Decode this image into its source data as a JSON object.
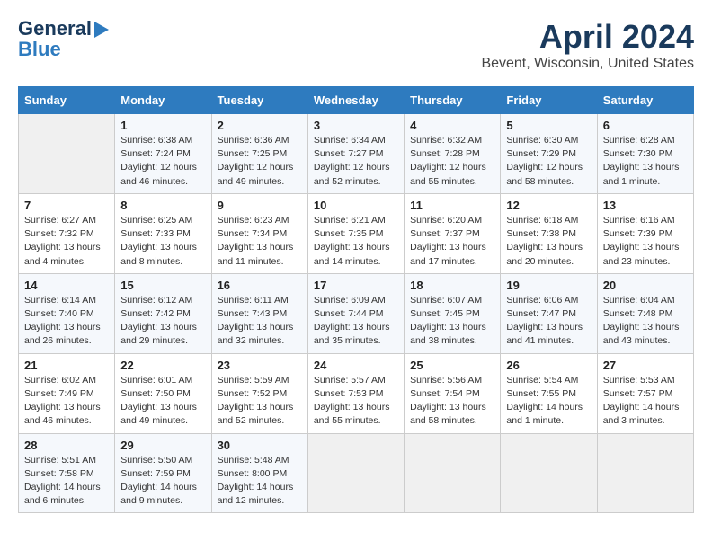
{
  "header": {
    "logo_line1": "General",
    "logo_line2": "Blue",
    "title": "April 2024",
    "subtitle": "Bevent, Wisconsin, United States"
  },
  "days_of_week": [
    "Sunday",
    "Monday",
    "Tuesday",
    "Wednesday",
    "Thursday",
    "Friday",
    "Saturday"
  ],
  "weeks": [
    [
      {
        "day": "",
        "info": ""
      },
      {
        "day": "1",
        "info": "Sunrise: 6:38 AM\nSunset: 7:24 PM\nDaylight: 12 hours\nand 46 minutes."
      },
      {
        "day": "2",
        "info": "Sunrise: 6:36 AM\nSunset: 7:25 PM\nDaylight: 12 hours\nand 49 minutes."
      },
      {
        "day": "3",
        "info": "Sunrise: 6:34 AM\nSunset: 7:27 PM\nDaylight: 12 hours\nand 52 minutes."
      },
      {
        "day": "4",
        "info": "Sunrise: 6:32 AM\nSunset: 7:28 PM\nDaylight: 12 hours\nand 55 minutes."
      },
      {
        "day": "5",
        "info": "Sunrise: 6:30 AM\nSunset: 7:29 PM\nDaylight: 12 hours\nand 58 minutes."
      },
      {
        "day": "6",
        "info": "Sunrise: 6:28 AM\nSunset: 7:30 PM\nDaylight: 13 hours\nand 1 minute."
      }
    ],
    [
      {
        "day": "7",
        "info": "Sunrise: 6:27 AM\nSunset: 7:32 PM\nDaylight: 13 hours\nand 4 minutes."
      },
      {
        "day": "8",
        "info": "Sunrise: 6:25 AM\nSunset: 7:33 PM\nDaylight: 13 hours\nand 8 minutes."
      },
      {
        "day": "9",
        "info": "Sunrise: 6:23 AM\nSunset: 7:34 PM\nDaylight: 13 hours\nand 11 minutes."
      },
      {
        "day": "10",
        "info": "Sunrise: 6:21 AM\nSunset: 7:35 PM\nDaylight: 13 hours\nand 14 minutes."
      },
      {
        "day": "11",
        "info": "Sunrise: 6:20 AM\nSunset: 7:37 PM\nDaylight: 13 hours\nand 17 minutes."
      },
      {
        "day": "12",
        "info": "Sunrise: 6:18 AM\nSunset: 7:38 PM\nDaylight: 13 hours\nand 20 minutes."
      },
      {
        "day": "13",
        "info": "Sunrise: 6:16 AM\nSunset: 7:39 PM\nDaylight: 13 hours\nand 23 minutes."
      }
    ],
    [
      {
        "day": "14",
        "info": "Sunrise: 6:14 AM\nSunset: 7:40 PM\nDaylight: 13 hours\nand 26 minutes."
      },
      {
        "day": "15",
        "info": "Sunrise: 6:12 AM\nSunset: 7:42 PM\nDaylight: 13 hours\nand 29 minutes."
      },
      {
        "day": "16",
        "info": "Sunrise: 6:11 AM\nSunset: 7:43 PM\nDaylight: 13 hours\nand 32 minutes."
      },
      {
        "day": "17",
        "info": "Sunrise: 6:09 AM\nSunset: 7:44 PM\nDaylight: 13 hours\nand 35 minutes."
      },
      {
        "day": "18",
        "info": "Sunrise: 6:07 AM\nSunset: 7:45 PM\nDaylight: 13 hours\nand 38 minutes."
      },
      {
        "day": "19",
        "info": "Sunrise: 6:06 AM\nSunset: 7:47 PM\nDaylight: 13 hours\nand 41 minutes."
      },
      {
        "day": "20",
        "info": "Sunrise: 6:04 AM\nSunset: 7:48 PM\nDaylight: 13 hours\nand 43 minutes."
      }
    ],
    [
      {
        "day": "21",
        "info": "Sunrise: 6:02 AM\nSunset: 7:49 PM\nDaylight: 13 hours\nand 46 minutes."
      },
      {
        "day": "22",
        "info": "Sunrise: 6:01 AM\nSunset: 7:50 PM\nDaylight: 13 hours\nand 49 minutes."
      },
      {
        "day": "23",
        "info": "Sunrise: 5:59 AM\nSunset: 7:52 PM\nDaylight: 13 hours\nand 52 minutes."
      },
      {
        "day": "24",
        "info": "Sunrise: 5:57 AM\nSunset: 7:53 PM\nDaylight: 13 hours\nand 55 minutes."
      },
      {
        "day": "25",
        "info": "Sunrise: 5:56 AM\nSunset: 7:54 PM\nDaylight: 13 hours\nand 58 minutes."
      },
      {
        "day": "26",
        "info": "Sunrise: 5:54 AM\nSunset: 7:55 PM\nDaylight: 14 hours\nand 1 minute."
      },
      {
        "day": "27",
        "info": "Sunrise: 5:53 AM\nSunset: 7:57 PM\nDaylight: 14 hours\nand 3 minutes."
      }
    ],
    [
      {
        "day": "28",
        "info": "Sunrise: 5:51 AM\nSunset: 7:58 PM\nDaylight: 14 hours\nand 6 minutes."
      },
      {
        "day": "29",
        "info": "Sunrise: 5:50 AM\nSunset: 7:59 PM\nDaylight: 14 hours\nand 9 minutes."
      },
      {
        "day": "30",
        "info": "Sunrise: 5:48 AM\nSunset: 8:00 PM\nDaylight: 14 hours\nand 12 minutes."
      },
      {
        "day": "",
        "info": ""
      },
      {
        "day": "",
        "info": ""
      },
      {
        "day": "",
        "info": ""
      },
      {
        "day": "",
        "info": ""
      }
    ]
  ]
}
